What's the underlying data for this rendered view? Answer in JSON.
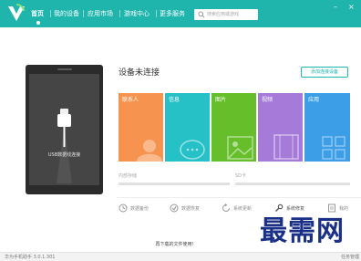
{
  "theme": {
    "accent": "#1fb5ad",
    "watermark_color": "#1a2f86"
  },
  "nav": {
    "items": [
      {
        "label": "首页",
        "active": true
      },
      {
        "label": "我的设备",
        "active": false
      },
      {
        "label": "应用市场",
        "active": false
      },
      {
        "label": "游戏中心",
        "active": false
      },
      {
        "label": "更多服务",
        "active": false
      }
    ],
    "search_placeholder": "搜索应用或游戏"
  },
  "window_controls": {
    "minimize": "–",
    "close": "×"
  },
  "device": {
    "status_title": "设备未连接",
    "add_button": "添加连接设备",
    "hint": "USB数据线连接"
  },
  "tiles": [
    {
      "label": "联系人",
      "color": "#f6944f",
      "icon": "person-icon"
    },
    {
      "label": "信息",
      "color": "#26c0c7",
      "icon": "chat-icon"
    },
    {
      "label": "图片",
      "color": "#67be2b",
      "icon": "image-icon"
    },
    {
      "label": "视频",
      "color": "#a67ad9",
      "icon": "film-icon"
    },
    {
      "label": "应用",
      "color": "#3d9ee8",
      "icon": "apps-icon"
    }
  ],
  "storage": {
    "internal_label": "内部存储",
    "sd_label": "SD卡"
  },
  "tools": [
    {
      "label": "数据备份",
      "icon": "backup-icon"
    },
    {
      "label": "数据恢复",
      "icon": "restore-icon"
    },
    {
      "label": "系统更新",
      "icon": "update-icon"
    },
    {
      "label": "系统修复",
      "icon": "wrench-icon"
    },
    {
      "label": "我的",
      "icon": "doc-icon"
    }
  ],
  "banner": "再下载的文件使用！",
  "footer": {
    "version": "华为手机助手 3.0.1.301",
    "task_manager": "任务管理"
  },
  "watermark": "最需网"
}
